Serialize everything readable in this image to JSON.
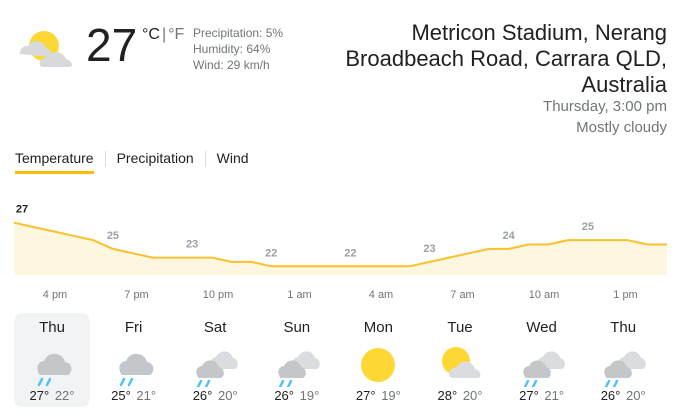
{
  "current": {
    "icon": "partly-cloudy-icon",
    "temperature": "27",
    "unit_c": "°C",
    "unit_sep": "|",
    "unit_f": "°F",
    "precipitation": "Precipitation: 5%",
    "humidity": "Humidity: 64%",
    "wind": "Wind: 29 km/h"
  },
  "location": {
    "name": "Metricon Stadium, Nerang Broadbeach Road, Carrara QLD, Australia",
    "datetime": "Thursday, 3:00 pm",
    "condition": "Mostly cloudy"
  },
  "tabs": [
    {
      "label": "Temperature",
      "active": true
    },
    {
      "label": "Precipitation",
      "active": false
    },
    {
      "label": "Wind",
      "active": false
    }
  ],
  "colors": {
    "accent": "#fbbc04",
    "fill": "#fef7e0",
    "line": "#fbc02d",
    "rain": "#4fc3f7"
  },
  "chart_data": {
    "type": "area",
    "series_values": [
      27,
      26.5,
      26,
      25.5,
      25,
      24,
      23.5,
      23,
      23,
      23,
      23,
      22.5,
      22.5,
      22,
      22,
      22,
      22,
      22,
      22,
      22,
      22,
      22.5,
      23,
      23.5,
      24,
      24,
      24.5,
      24.5,
      25,
      25,
      25,
      25,
      24.5,
      24.5
    ],
    "labels": [
      {
        "index": 0,
        "value": "27",
        "bold": true
      },
      {
        "index": 5,
        "value": "25"
      },
      {
        "index": 9,
        "value": "23"
      },
      {
        "index": 13,
        "value": "22"
      },
      {
        "index": 17,
        "value": "22"
      },
      {
        "index": 21,
        "value": "23"
      },
      {
        "index": 25,
        "value": "24"
      },
      {
        "index": 29,
        "value": "25"
      }
    ],
    "time_labels": [
      "4 pm",
      "7 pm",
      "10 pm",
      "1 am",
      "4 am",
      "7 am",
      "10 am",
      "1 pm"
    ],
    "ylim": [
      21,
      28
    ]
  },
  "forecast": [
    {
      "day": "Thu",
      "icon": "rain-cloud-icon",
      "hi": "27°",
      "lo": "22°",
      "selected": true
    },
    {
      "day": "Fri",
      "icon": "rain-cloud-icon",
      "hi": "25°",
      "lo": "21°",
      "selected": false
    },
    {
      "day": "Sat",
      "icon": "cloud-rain-icon",
      "hi": "26°",
      "lo": "20°",
      "selected": false
    },
    {
      "day": "Sun",
      "icon": "cloud-rain-icon",
      "hi": "26°",
      "lo": "19°",
      "selected": false
    },
    {
      "day": "Mon",
      "icon": "sun-icon",
      "hi": "27°",
      "lo": "19°",
      "selected": false
    },
    {
      "day": "Tue",
      "icon": "partly-cloudy-icon",
      "hi": "28°",
      "lo": "20°",
      "selected": false
    },
    {
      "day": "Wed",
      "icon": "cloud-rain-icon",
      "hi": "27°",
      "lo": "21°",
      "selected": false
    },
    {
      "day": "Thu",
      "icon": "cloud-rain-icon",
      "hi": "26°",
      "lo": "20°",
      "selected": false
    }
  ]
}
